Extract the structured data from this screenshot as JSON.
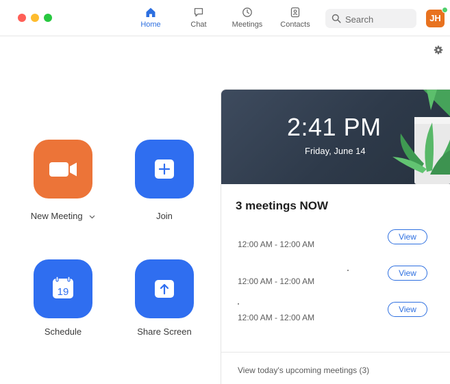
{
  "titlebar": {
    "window_controls": [
      "close",
      "minimize",
      "maximize"
    ]
  },
  "nav": {
    "tabs": [
      {
        "label": "Home",
        "icon": "home-icon",
        "active": true
      },
      {
        "label": "Chat",
        "icon": "chat-bubble-icon",
        "active": false
      },
      {
        "label": "Meetings",
        "icon": "clock-icon",
        "active": false
      },
      {
        "label": "Contacts",
        "icon": "contact-card-icon",
        "active": false
      }
    ]
  },
  "search": {
    "placeholder": "Search",
    "icon": "search-icon"
  },
  "user": {
    "initials": "JH",
    "status": "online"
  },
  "settings": {
    "icon": "gear-icon"
  },
  "actions": [
    {
      "label": "New Meeting",
      "icon": "video-camera-icon",
      "color": "#ec7438",
      "has_dropdown": true
    },
    {
      "label": "Join",
      "icon": "plus-icon",
      "color": "#2f6ef0"
    },
    {
      "label": "Schedule",
      "icon": "calendar-icon",
      "calendar_day": "19",
      "color": "#2f6ef0"
    },
    {
      "label": "Share Screen",
      "icon": "share-up-arrow-icon",
      "color": "#2f6ef0"
    }
  ],
  "panel": {
    "time": "2:41 PM",
    "date": "Friday, June 14",
    "meetings_heading": "3 meetings NOW",
    "meetings": [
      {
        "time_range": "12:00 AM - 12:00 AM",
        "button_label": "View"
      },
      {
        "time_range": "12:00 AM - 12:00 AM",
        "button_label": "View"
      },
      {
        "time_range": "12:00 AM - 12:00 AM",
        "button_label": "View"
      }
    ],
    "upcoming_link": "View today's upcoming meetings (3)"
  },
  "colors": {
    "accent": "#2d6fe0",
    "new_meeting": "#ec7438",
    "tile_blue": "#2f6ef0",
    "avatar": "#e8721f",
    "status_online": "#4fd06d",
    "hero_background": "#2e3a4a"
  }
}
